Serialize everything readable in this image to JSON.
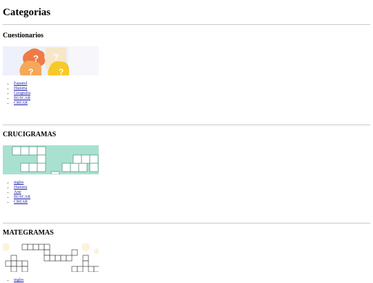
{
  "page": {
    "title": "Categorias"
  },
  "sections": [
    {
      "heading": "Cuestionarios",
      "links": [
        "Espanol",
        "Historia",
        "Geografia",
        "BUSCAR",
        "CREAR"
      ]
    },
    {
      "heading": "CRUCIGRAMAS",
      "links": [
        "ingles",
        "Historia",
        "Arte",
        "BUSCAR",
        "CREAR"
      ]
    },
    {
      "heading": "MATEGRAMAS",
      "links": [
        "ingles"
      ]
    }
  ],
  "colors": {
    "quiz_bg": "#eef0fb",
    "quiz_bubble_1": "#f07a44",
    "quiz_bubble_2": "#f4a85a",
    "quiz_bubble_3": "#f7c928",
    "crossword_bg": "#a9e1d0",
    "mategrama_bg": "#fdf2dc",
    "link": "#1a1aa6"
  }
}
